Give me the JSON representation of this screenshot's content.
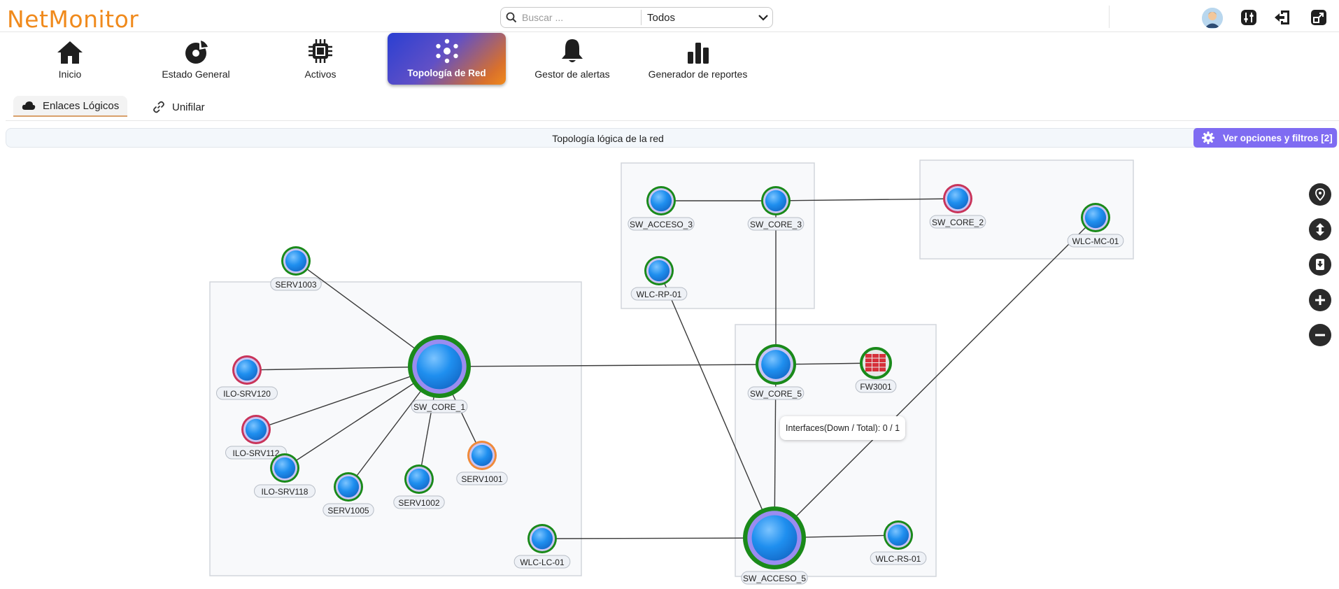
{
  "app": {
    "logo_text": "NetMonitor",
    "accent_color": "#f08a1c"
  },
  "search": {
    "placeholder": "Buscar ...",
    "filter_value": "Todos",
    "search_icon": "search-icon",
    "dropdown_icon": "chevron-down-icon"
  },
  "header_icons": [
    "avatar",
    "settings-sliders-icon",
    "logout-icon",
    "external-window-icon"
  ],
  "nav": {
    "items": [
      {
        "label": "Inicio",
        "icon": "home-icon"
      },
      {
        "label": "Estado General",
        "icon": "dashboard-icon"
      },
      {
        "label": "Activos",
        "icon": "cpu-icon"
      },
      {
        "label": "Topología de Red",
        "icon": "network-icon",
        "active": true
      },
      {
        "label": "Gestor de alertas",
        "icon": "bell-icon"
      },
      {
        "label": "Generador de reportes",
        "icon": "bar-chart-icon"
      }
    ]
  },
  "subtabs": [
    {
      "label": "Enlaces Lógicos",
      "icon": "cloud-icon",
      "active": true
    },
    {
      "label": "Unifilar",
      "icon": "link-icon"
    }
  ],
  "panel": {
    "title": "Topología lógica de la red",
    "options_button": "Ver opciones y filtros [2]",
    "options_icon": "gear-icon"
  },
  "tooltip": {
    "text": "Interfaces(Down / Total): 0 / 1"
  },
  "map_controls": [
    "location-pin-icon",
    "fit-vertical-icon",
    "download-icon",
    "zoom-in-icon",
    "zoom-out-icon"
  ],
  "topology": {
    "nodes": [
      {
        "id": "SW_CORE_1",
        "label": "SW_CORE_1",
        "status": "up",
        "kind": "core"
      },
      {
        "id": "SERV1003",
        "label": "SERV1003",
        "status": "up",
        "kind": "device"
      },
      {
        "id": "ILO-SRV120",
        "label": "ILO-SRV120",
        "status": "down",
        "kind": "device"
      },
      {
        "id": "ILO-SRV112",
        "label": "ILO-SRV112",
        "status": "down",
        "kind": "device"
      },
      {
        "id": "ILO-SRV118",
        "label": "ILO-SRV118",
        "status": "up",
        "kind": "device"
      },
      {
        "id": "SERV1005",
        "label": "SERV1005",
        "status": "up",
        "kind": "device"
      },
      {
        "id": "SERV1002",
        "label": "SERV1002",
        "status": "up",
        "kind": "device"
      },
      {
        "id": "SERV1001",
        "label": "SERV1001",
        "status": "warning",
        "kind": "device"
      },
      {
        "id": "WLC-LC-01",
        "label": "WLC-LC-01",
        "status": "up",
        "kind": "device"
      },
      {
        "id": "SW_ACCESO_3",
        "label": "SW_ACCESO_3",
        "status": "up",
        "kind": "device"
      },
      {
        "id": "SW_CORE_3",
        "label": "SW_CORE_3",
        "status": "up",
        "kind": "device"
      },
      {
        "id": "WLC-RP-01",
        "label": "WLC-RP-01",
        "status": "up",
        "kind": "device"
      },
      {
        "id": "SW_CORE_2",
        "label": "SW_CORE_2",
        "status": "down",
        "kind": "device"
      },
      {
        "id": "WLC-MC-01",
        "label": "WLC-MC-01",
        "status": "up",
        "kind": "device"
      },
      {
        "id": "SW_CORE_5",
        "label": "SW_CORE_5",
        "status": "up",
        "kind": "hub"
      },
      {
        "id": "FW3001",
        "label": "FW3001",
        "status": "up",
        "kind": "firewall"
      },
      {
        "id": "SW_ACCESO_5",
        "label": "SW_ACCESO_5",
        "status": "up",
        "kind": "core"
      },
      {
        "id": "WLC-RS-01",
        "label": "WLC-RS-01",
        "status": "up",
        "kind": "device"
      }
    ],
    "links": [
      [
        "SW_CORE_1",
        "SERV1003"
      ],
      [
        "SW_CORE_1",
        "ILO-SRV120"
      ],
      [
        "SW_CORE_1",
        "ILO-SRV112"
      ],
      [
        "SW_CORE_1",
        "ILO-SRV118"
      ],
      [
        "SW_CORE_1",
        "SERV1005"
      ],
      [
        "SW_CORE_1",
        "SERV1002"
      ],
      [
        "SW_CORE_1",
        "SERV1001"
      ],
      [
        "SW_CORE_1",
        "SW_CORE_5"
      ],
      [
        "SW_ACCESO_3",
        "SW_CORE_3"
      ],
      [
        "SW_CORE_3",
        "SW_CORE_2"
      ],
      [
        "SW_CORE_3",
        "SW_CORE_5"
      ],
      [
        "WLC-RP-01",
        "SW_ACCESO_5"
      ],
      [
        "WLC-MC-01",
        "SW_ACCESO_5"
      ],
      [
        "SW_CORE_5",
        "FW3001"
      ],
      [
        "SW_CORE_5",
        "SW_ACCESO_5"
      ],
      [
        "SW_ACCESO_5",
        "WLC-RS-01"
      ],
      [
        "WLC-LC-01",
        "SW_ACCESO_5"
      ]
    ],
    "status_colors": {
      "up": "#1a8a1a",
      "down": "#c9345a",
      "warning": "#f08a3a",
      "node_fill": "#1f8fef"
    }
  }
}
